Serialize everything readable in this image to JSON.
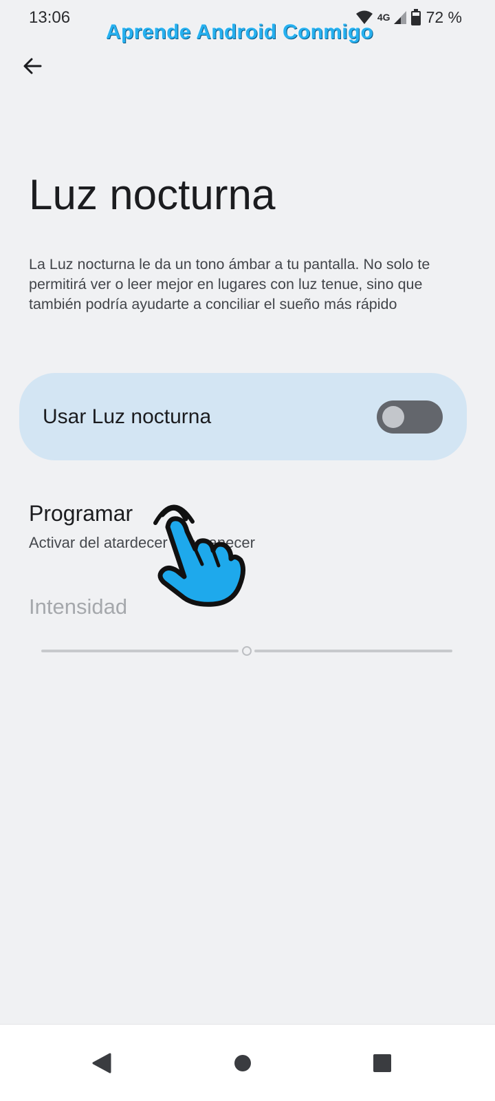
{
  "status_bar": {
    "time": "13:06",
    "network": "4G",
    "battery": "72 %",
    "icons": [
      "wifi-icon",
      "signal-icon",
      "battery-icon"
    ]
  },
  "watermark": "Aprende Android Conmigo",
  "header": {
    "back_icon": "arrow-left-icon"
  },
  "page": {
    "title": "Luz nocturna",
    "description": "La Luz nocturna le da un tono ámbar a tu pantalla. No solo te permitirá ver o leer mejor en lugares con luz tenue, sino que también podría ayudarte a conciliar el sueño más rápido"
  },
  "toggle": {
    "label": "Usar Luz nocturna",
    "enabled": false
  },
  "schedule": {
    "title": "Programar",
    "subtitle": "Activar del atardecer al amanecer"
  },
  "intensity": {
    "label": "Intensidad",
    "value_fraction": 0.5,
    "disabled": true
  },
  "nav_bar": {
    "icons": [
      "back-triangle-icon",
      "home-circle-icon",
      "recents-square-icon"
    ]
  },
  "colors": {
    "background": "#f0f1f3",
    "card": "#d3e5f3",
    "switch_off": "#63666c",
    "watermark": "#27b0ef",
    "hand": "#1ea9ec"
  }
}
